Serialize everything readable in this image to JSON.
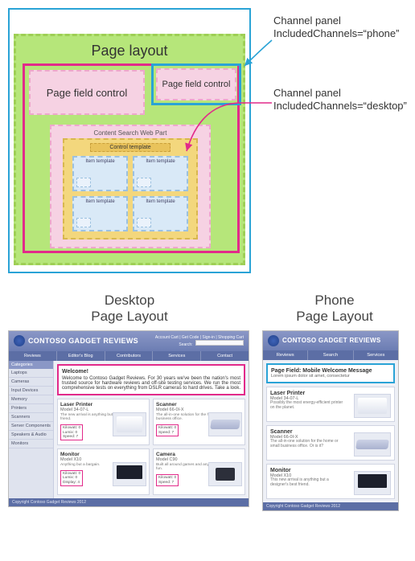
{
  "diagram": {
    "title": "Page layout",
    "page_field_control_label": "Page field control",
    "cswp_title": "Content Search Web Part",
    "control_template_label": "Control template",
    "item_template_label": "Item template",
    "callout_phone_line1": "Channel panel",
    "callout_phone_line2": "IncludedChannels=“phone”",
    "callout_desktop_line1": "Channel panel",
    "callout_desktop_line2": "IncludedChannels=“desktop”"
  },
  "layout_headers": {
    "desktop": "Desktop\nPage Layout",
    "phone": "Phone\nPage Layout"
  },
  "brand": {
    "title": "CONTOSO GADGET REVIEWS",
    "right_links": "Account Cart | Get Code | Sign-in | Shopping Cart",
    "search_label": "Search:"
  },
  "desktop": {
    "nav": [
      "Reviews",
      "Editor's Blog",
      "Contributors",
      "Services",
      "Contact"
    ],
    "sidebar_header": "Categories",
    "sidebar_items": [
      "Laptops",
      "Cameras",
      "Input Devices",
      "Memory",
      "Printers",
      "Scanners",
      "Server Components",
      "Speakers & Audio",
      "Monitors"
    ],
    "welcome_heading": "Welcome!",
    "welcome_body": "Welcome to Contoso Gadget Reviews.  For 30 years we've been the nation's most trusted source for hardware reviews and off-site testing services.  We run the most comprehensive tests on everything from DSLR cameras to hard drives.  Take a look.",
    "products": [
      {
        "name": "Laser Printer",
        "model": "Model 34-07-L",
        "blurb": "The new arrival is anything but a designer's best friend.",
        "details": "Kilowatt: 0\nLumix: 0\nSpeed: 7",
        "img": "printer"
      },
      {
        "name": "Scanner",
        "model": "Model 66-0I-X",
        "blurb": "The all-in-one solution for the home or small business office.",
        "details": "Kilowatt: 0\nSpeed: 7",
        "img": "scanner"
      },
      {
        "name": "Monitor",
        "model": "Model X10",
        "blurb": "Anything but a bargain.",
        "details": "Kilowatt: 0\nLumix: 0\nDisplay: 4",
        "img": "monitor"
      },
      {
        "name": "Camera",
        "model": "Model C90",
        "blurb": "Built all around games and anything but digital fun.",
        "details": "Kilowatt: 0\nSpeed: 7",
        "img": "camera"
      }
    ],
    "footer": "Copyright Contoso Gadget Reviews 2012"
  },
  "phone": {
    "nav": [
      "Reviews",
      "Search",
      "Services"
    ],
    "mobile_msg_heading": "Page Field: Mobile Welcome Message",
    "mobile_msg_body": "Lorem ipsum dolor sit amet, consectetur",
    "products": [
      {
        "name": "Laser Printer",
        "model": "Model 34-07-L",
        "blurb": "Possibly the most energy-efficient printer on the planet.",
        "img": "printer"
      },
      {
        "name": "Scanner",
        "model": "Model 66-0I-X",
        "blurb": "The all-in-one solution for the home or small business office. Or is it?",
        "img": "scanner"
      },
      {
        "name": "Monitor",
        "model": "Model X10",
        "blurb": "This new arrival is anything but a designer's best friend.",
        "img": "monitor"
      }
    ],
    "footer": "Copyright Contoso Gadget Reviews 2012"
  }
}
